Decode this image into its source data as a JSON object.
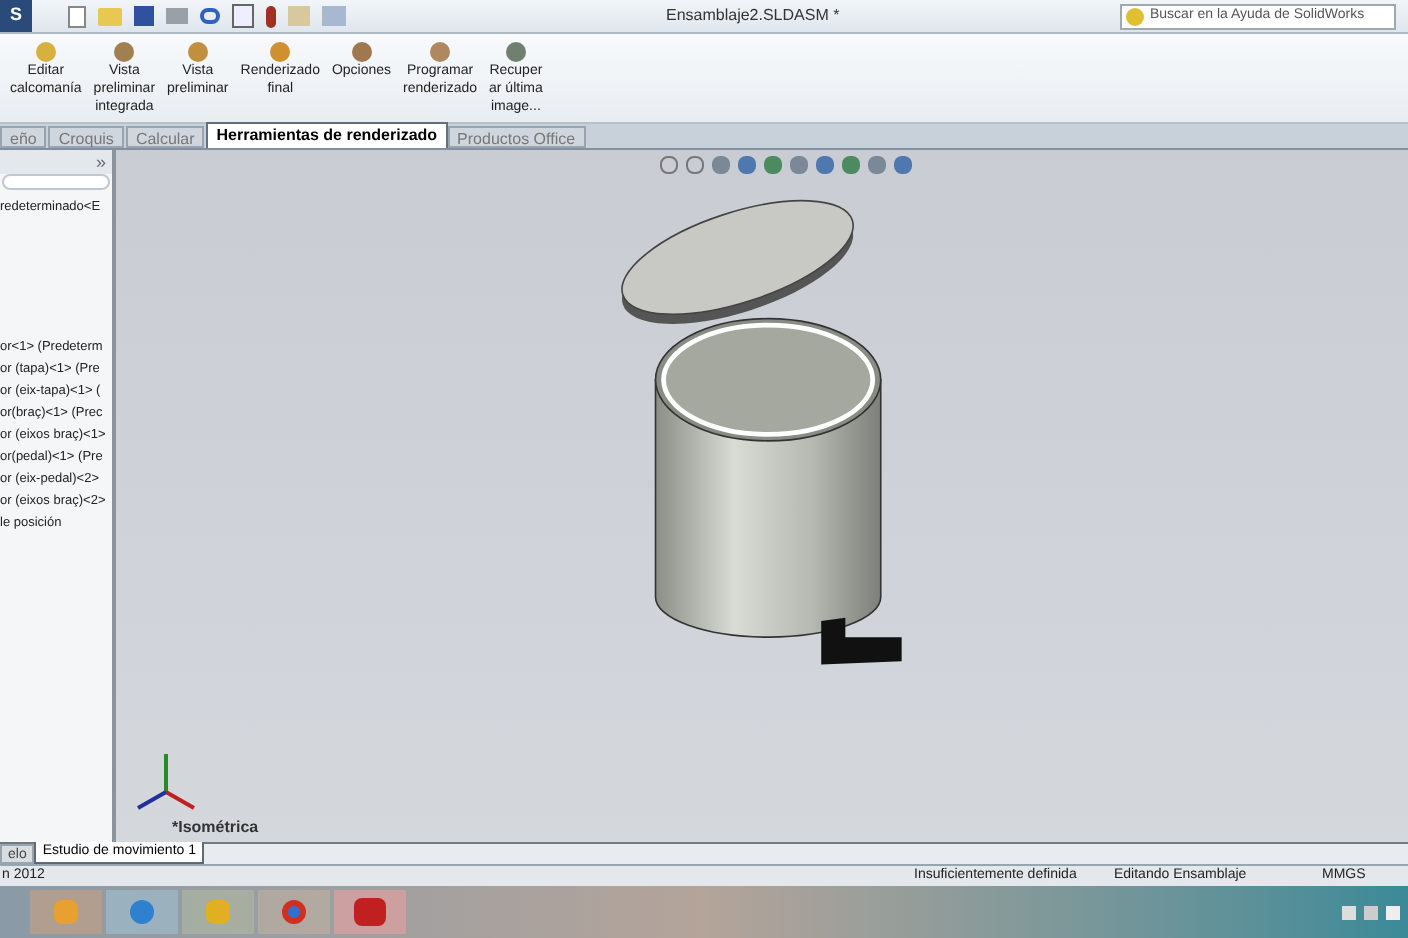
{
  "window": {
    "menu_label": "S",
    "title": "Ensamblaje2.SLDASM *"
  },
  "help_search": {
    "placeholder": "Buscar en la Ayuda de SolidWorks"
  },
  "ribbon": [
    {
      "label": "Editar\ncalcomanía"
    },
    {
      "label": "Vista\npreliminar\nintegrada"
    },
    {
      "label": "Vista\npreliminar"
    },
    {
      "label": "Renderizado\nfinal"
    },
    {
      "label": "Opciones"
    },
    {
      "label": "Programar\nrenderizado"
    },
    {
      "label": "Recuper\nar última\nimage..."
    }
  ],
  "tabs": [
    {
      "label": "eño",
      "selected": false
    },
    {
      "label": "Croquis",
      "selected": false
    },
    {
      "label": "Calcular",
      "selected": false
    },
    {
      "label": "Herramientas de renderizado",
      "selected": true
    },
    {
      "label": "Productos Office",
      "selected": false
    }
  ],
  "tree": {
    "collapse_label": "»",
    "items": [
      "redeterminado<E",
      "or<1> (Predeterm",
      "or (tapa)<1> (Pre",
      "or (eix-tapa)<1> (",
      "or(braç)<1> (Prec",
      "or (eixos braç)<1>",
      "or(pedal)<1> (Pre",
      "or (eix-pedal)<2>",
      "or (eixos braç)<2>",
      "le posición"
    ]
  },
  "viewport": {
    "view_label": "*Isométrica"
  },
  "bottom_tabs": [
    {
      "label": "elo",
      "selected": false
    },
    {
      "label": "Estudio de movimiento 1",
      "selected": true
    }
  ],
  "status_bar": {
    "left": "n 2012",
    "items": [
      "Insuficientemente definida",
      "Editando Ensamblaje",
      "MMGS"
    ]
  }
}
